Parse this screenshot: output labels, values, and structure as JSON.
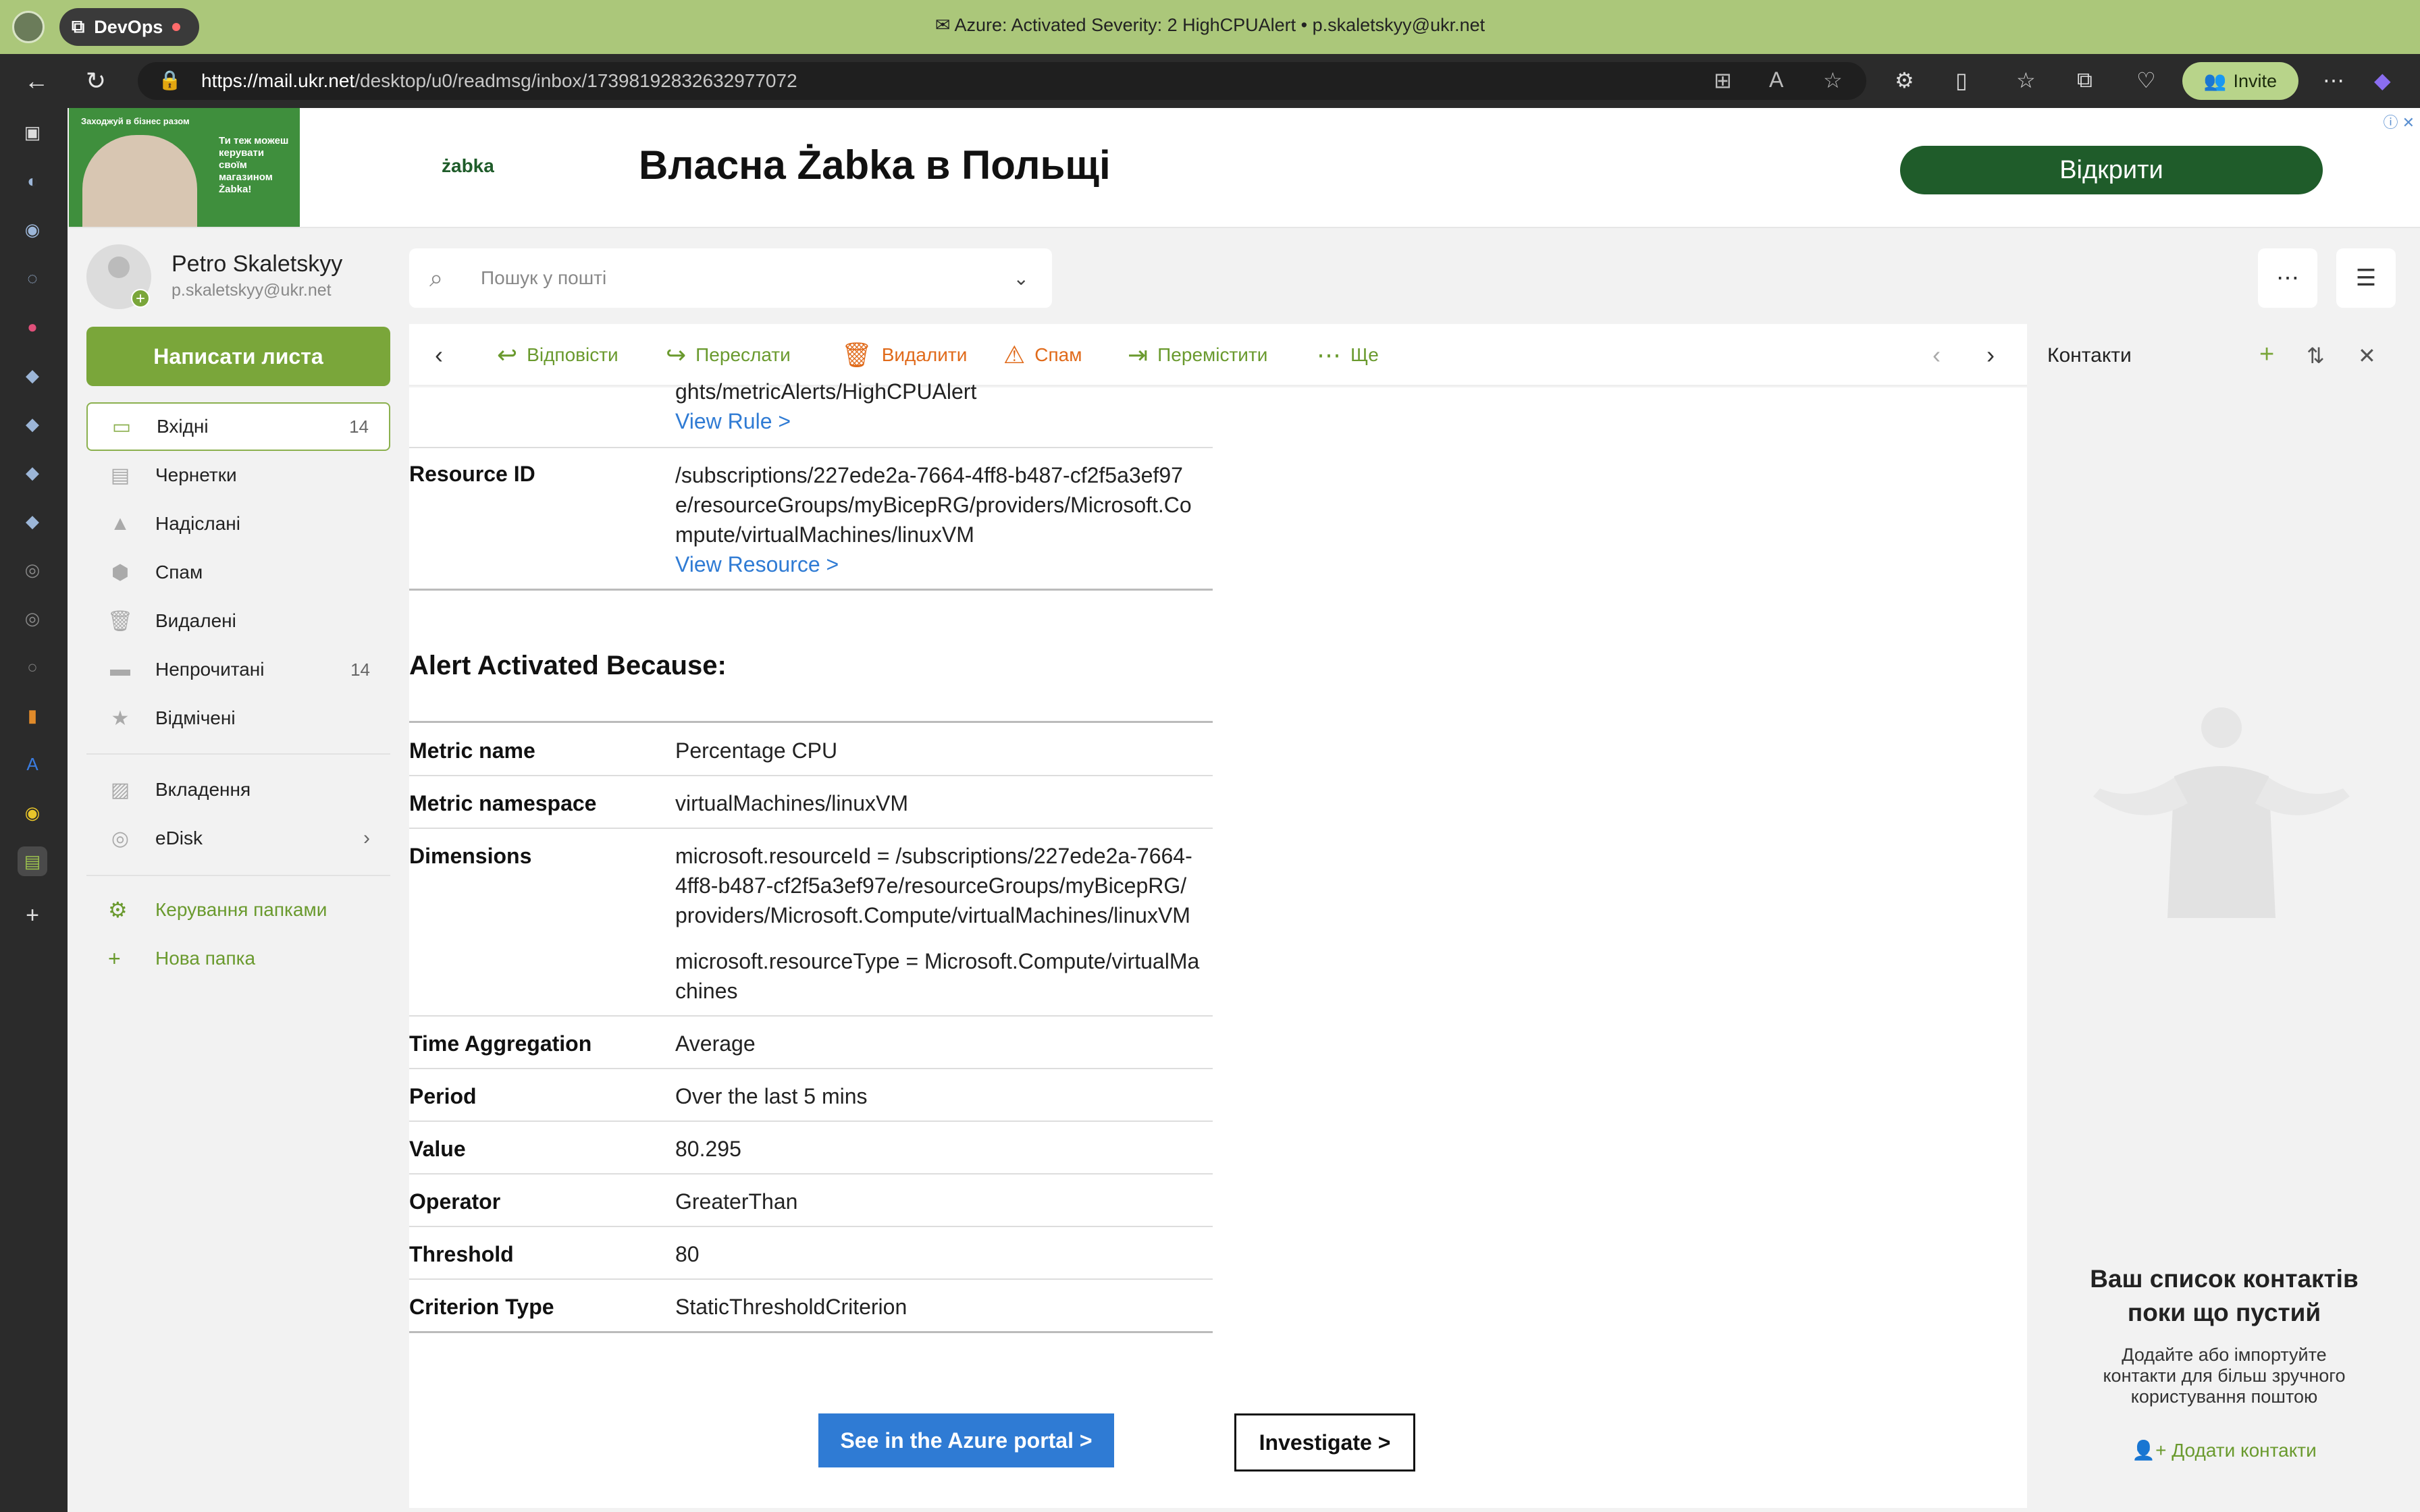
{
  "browser": {
    "tab_group": "DevOps",
    "window_title": "Azure: Activated Severity: 2 HighCPUAlert • p.skaletskyy@ukr.net",
    "url_host": "https://mail.ukr.net",
    "url_path": "/desktop/u0/readmsg/inbox/17398192832632977072",
    "invite_label": "Invite"
  },
  "ad": {
    "banner_top": "Заходжуй в бізнес разом",
    "banner_text": "Ти теж можеш керувати своїм магазином Żabka!",
    "logo": "żabka",
    "headline": "Власна Żabka в Польщі",
    "button": "Відкрити"
  },
  "user": {
    "name": "Petro Skaletskyy",
    "email": "p.skaletskyy@ukr.net"
  },
  "compose_label": "Написати листа",
  "folders": [
    {
      "label": "Вхідні",
      "count": "14",
      "icon": "inbox-icon"
    },
    {
      "label": "Чернетки",
      "count": "",
      "icon": "draft-icon"
    },
    {
      "label": "Надіслані",
      "count": "",
      "icon": "sent-icon"
    },
    {
      "label": "Спам",
      "count": "",
      "icon": "spam-icon"
    },
    {
      "label": "Видалені",
      "count": "",
      "icon": "trash-icon"
    },
    {
      "label": "Непрочитані",
      "count": "14",
      "icon": "unread-icon"
    },
    {
      "label": "Відмічені",
      "count": "",
      "icon": "star-icon"
    }
  ],
  "extra_folders": [
    {
      "label": "Вкладення",
      "icon": "attachment-icon"
    },
    {
      "label": "eDisk",
      "icon": "disk-icon"
    }
  ],
  "folder_actions": {
    "manage": "Керування папками",
    "new_folder": "Нова папка"
  },
  "search": {
    "placeholder": "Пошук у пошті"
  },
  "toolbar": {
    "reply": "Відповісти",
    "forward": "Переслати",
    "delete": "Видалити",
    "spam": "Спам",
    "move": "Перемістити",
    "more": "Ще"
  },
  "message": {
    "rule_path_tail": "ghts/metricAlerts/HighCPUAlert",
    "view_rule": "View Rule >",
    "resource_id_label": "Resource ID",
    "resource_id_lines": [
      "/subscriptions/227ede2a-7664-4ff8-b487-cf2f5a3ef97",
      "e/resourceGroups/myBicepRG/providers/Microsoft.Co",
      "mpute/virtualMachines/linuxVM"
    ],
    "view_resource": "View Resource >",
    "section_title": "Alert Activated Because:",
    "rows": [
      {
        "label": "Metric name",
        "value": "Percentage CPU"
      },
      {
        "label": "Metric namespace",
        "value": "virtualMachines/linuxVM"
      },
      {
        "label": "Time Aggregation",
        "value": "Average"
      },
      {
        "label": "Period",
        "value": "Over the last 5 mins"
      },
      {
        "label": "Value",
        "value": "80.295"
      },
      {
        "label": "Operator",
        "value": "GreaterThan"
      },
      {
        "label": "Threshold",
        "value": "80"
      },
      {
        "label": "Criterion Type",
        "value": "StaticThresholdCriterion"
      }
    ],
    "dimensions_label": "Dimensions",
    "dimensions_lines": [
      "microsoft.resourceId = /subscriptions/227ede2a-7664-",
      "4ff8-b487-cf2f5a3ef97e/resourceGroups/myBicepRG/",
      "providers/Microsoft.Compute/virtualMachines/linuxVM"
    ],
    "dimensions_lines_2": [
      "microsoft.resourceType = Microsoft.Compute/virtualMa",
      "chines"
    ],
    "azure_button": "See in the Azure portal >",
    "investigate_button": "Investigate >"
  },
  "contacts": {
    "title": "Контакти",
    "empty_title_1": "Ваш список контактів",
    "empty_title_2": "поки що пустий",
    "empty_text_1": "Додайте або імпортуйте",
    "empty_text_2": "контакти для більш зручного",
    "empty_text_3": "користування поштою",
    "add_label": "Додати контакти"
  },
  "colors": {
    "accent_green": "#7aa63a",
    "link_blue": "#2f7bd4",
    "delete_orange": "#e06a1a",
    "titlebar": "#abc77a"
  }
}
